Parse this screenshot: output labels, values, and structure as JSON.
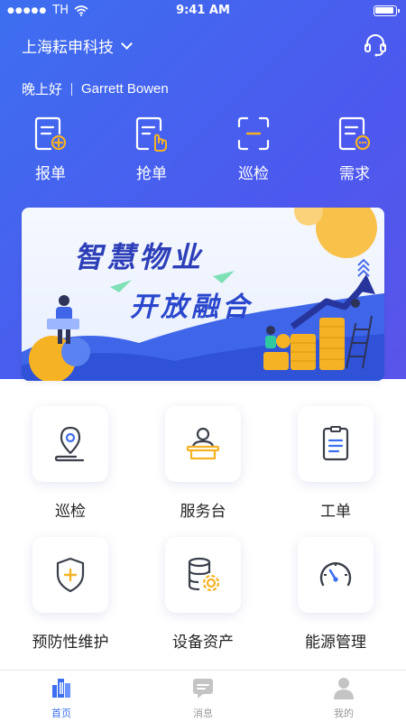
{
  "status_bar": {
    "carrier": "TH",
    "time": "9:41 AM"
  },
  "header": {
    "company": "上海耘申科技",
    "greeting": "晚上好",
    "user_name": "Garrett Bowen"
  },
  "quick_actions": [
    {
      "label": "报单",
      "icon": "report-doc-icon"
    },
    {
      "label": "抢单",
      "icon": "grab-order-icon"
    },
    {
      "label": "巡检",
      "icon": "scan-icon"
    },
    {
      "label": "需求",
      "icon": "request-doc-icon"
    }
  ],
  "banner": {
    "line1": "智慧物业",
    "line2": "开放融合"
  },
  "services": [
    {
      "label": "巡检",
      "icon": "location-pin-icon"
    },
    {
      "label": "服务台",
      "icon": "service-desk-icon"
    },
    {
      "label": "工单",
      "icon": "clipboard-icon"
    },
    {
      "label": "预防性维护",
      "icon": "shield-plus-icon"
    },
    {
      "label": "设备资产",
      "icon": "database-gear-icon"
    },
    {
      "label": "能源管理",
      "icon": "gauge-icon"
    }
  ],
  "tabs": [
    {
      "label": "首页",
      "icon": "home-buildings-icon",
      "active": true
    },
    {
      "label": "消息",
      "icon": "message-icon",
      "active": false
    },
    {
      "label": "我的",
      "icon": "profile-icon",
      "active": false
    }
  ],
  "colors": {
    "primary": "#3c6ff0",
    "accent_yellow": "#f5b324",
    "icon_dark": "#3a3f4a"
  }
}
